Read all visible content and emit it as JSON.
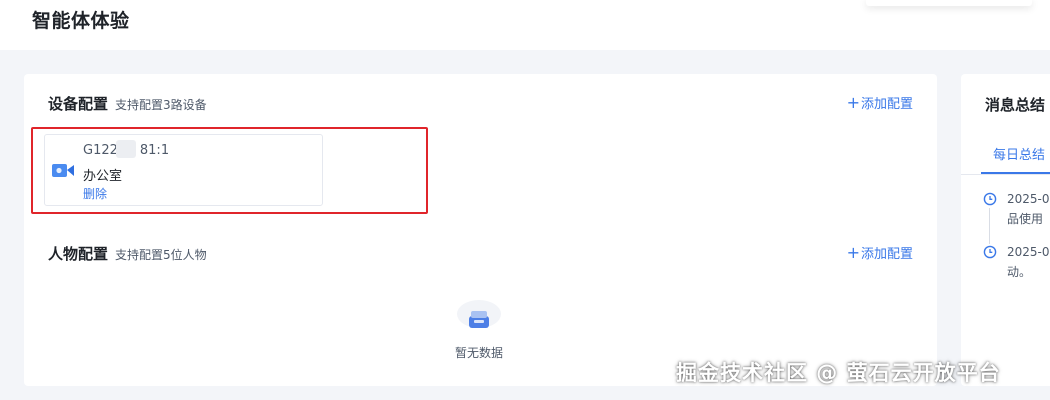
{
  "page": {
    "title": "智能体体验"
  },
  "device_section": {
    "title": "设备配置",
    "subtitle": "支持配置3路设备",
    "add_label": "添加配置",
    "devices": [
      {
        "id_prefix": "G122",
        "id_suffix": "81:1",
        "name": "办公室",
        "delete_label": "删除",
        "icon": "camera-icon"
      }
    ]
  },
  "person_section": {
    "title": "人物配置",
    "subtitle": "支持配置5位人物",
    "add_label": "添加配置",
    "empty_text": "暂无数据"
  },
  "message_panel": {
    "title": "消息总结",
    "tab": "每日总结",
    "items": [
      {
        "line1": "2025-0",
        "line2": "品使用"
      },
      {
        "line1": "2025-0",
        "line2": "动。"
      }
    ]
  },
  "watermark": "掘金技术社区 @ 萤石云开放平台",
  "colors": {
    "accent": "#3a78e8",
    "highlight": "#e0252b",
    "background": "#f3f5f9"
  }
}
